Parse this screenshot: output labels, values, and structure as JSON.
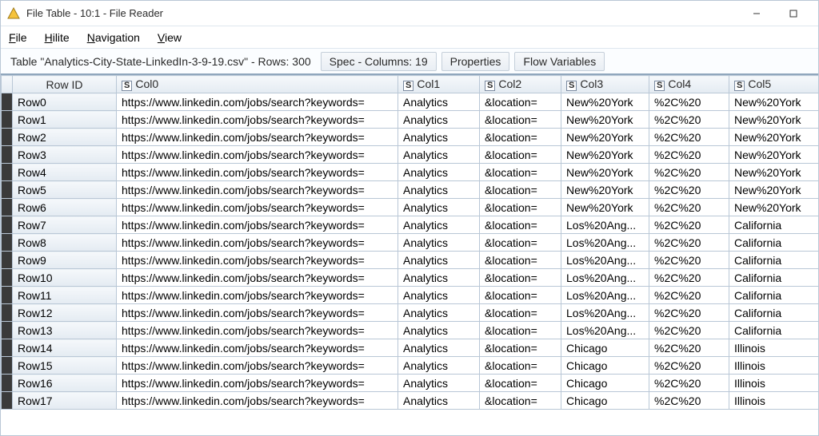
{
  "window": {
    "title": "File Table - 10:1 - File Reader"
  },
  "menu": {
    "file": {
      "accel": "F",
      "rest": "ile"
    },
    "hilite": {
      "accel": "H",
      "rest": "ilite"
    },
    "nav": {
      "accel": "N",
      "rest": "avigation"
    },
    "view": {
      "accel": "V",
      "rest": "iew"
    }
  },
  "toolbar": {
    "status": "Table \"Analytics-City-State-LinkedIn-3-9-19.csv\" - Rows: 300",
    "tab_spec": "Spec - Columns: 19",
    "tab_props": "Properties",
    "tab_flow": "Flow Variables"
  },
  "grid": {
    "rowid_header": "Row ID",
    "type_badge": "S",
    "columns": [
      "Col0",
      "Col1",
      "Col2",
      "Col3",
      "Col4",
      "Col5"
    ],
    "rows": [
      {
        "id": "Row0",
        "c": [
          "https://www.linkedin.com/jobs/search?keywords=",
          "Analytics",
          "&location=",
          "New%20York",
          "%2C%20",
          "New%20York"
        ]
      },
      {
        "id": "Row1",
        "c": [
          "https://www.linkedin.com/jobs/search?keywords=",
          "Analytics",
          "&location=",
          "New%20York",
          "%2C%20",
          "New%20York"
        ]
      },
      {
        "id": "Row2",
        "c": [
          "https://www.linkedin.com/jobs/search?keywords=",
          "Analytics",
          "&location=",
          "New%20York",
          "%2C%20",
          "New%20York"
        ]
      },
      {
        "id": "Row3",
        "c": [
          "https://www.linkedin.com/jobs/search?keywords=",
          "Analytics",
          "&location=",
          "New%20York",
          "%2C%20",
          "New%20York"
        ]
      },
      {
        "id": "Row4",
        "c": [
          "https://www.linkedin.com/jobs/search?keywords=",
          "Analytics",
          "&location=",
          "New%20York",
          "%2C%20",
          "New%20York"
        ]
      },
      {
        "id": "Row5",
        "c": [
          "https://www.linkedin.com/jobs/search?keywords=",
          "Analytics",
          "&location=",
          "New%20York",
          "%2C%20",
          "New%20York"
        ]
      },
      {
        "id": "Row6",
        "c": [
          "https://www.linkedin.com/jobs/search?keywords=",
          "Analytics",
          "&location=",
          "New%20York",
          "%2C%20",
          "New%20York"
        ]
      },
      {
        "id": "Row7",
        "c": [
          "https://www.linkedin.com/jobs/search?keywords=",
          "Analytics",
          "&location=",
          "Los%20Ang...",
          "%2C%20",
          "California"
        ]
      },
      {
        "id": "Row8",
        "c": [
          "https://www.linkedin.com/jobs/search?keywords=",
          "Analytics",
          "&location=",
          "Los%20Ang...",
          "%2C%20",
          "California"
        ]
      },
      {
        "id": "Row9",
        "c": [
          "https://www.linkedin.com/jobs/search?keywords=",
          "Analytics",
          "&location=",
          "Los%20Ang...",
          "%2C%20",
          "California"
        ]
      },
      {
        "id": "Row10",
        "c": [
          "https://www.linkedin.com/jobs/search?keywords=",
          "Analytics",
          "&location=",
          "Los%20Ang...",
          "%2C%20",
          "California"
        ]
      },
      {
        "id": "Row11",
        "c": [
          "https://www.linkedin.com/jobs/search?keywords=",
          "Analytics",
          "&location=",
          "Los%20Ang...",
          "%2C%20",
          "California"
        ]
      },
      {
        "id": "Row12",
        "c": [
          "https://www.linkedin.com/jobs/search?keywords=",
          "Analytics",
          "&location=",
          "Los%20Ang...",
          "%2C%20",
          "California"
        ]
      },
      {
        "id": "Row13",
        "c": [
          "https://www.linkedin.com/jobs/search?keywords=",
          "Analytics",
          "&location=",
          "Los%20Ang...",
          "%2C%20",
          "California"
        ]
      },
      {
        "id": "Row14",
        "c": [
          "https://www.linkedin.com/jobs/search?keywords=",
          "Analytics",
          "&location=",
          "Chicago",
          "%2C%20",
          "Illinois"
        ]
      },
      {
        "id": "Row15",
        "c": [
          "https://www.linkedin.com/jobs/search?keywords=",
          "Analytics",
          "&location=",
          "Chicago",
          "%2C%20",
          "Illinois"
        ]
      },
      {
        "id": "Row16",
        "c": [
          "https://www.linkedin.com/jobs/search?keywords=",
          "Analytics",
          "&location=",
          "Chicago",
          "%2C%20",
          "Illinois"
        ]
      },
      {
        "id": "Row17",
        "c": [
          "https://www.linkedin.com/jobs/search?keywords=",
          "Analytics",
          "&location=",
          "Chicago",
          "%2C%20",
          "Illinois"
        ]
      }
    ]
  }
}
